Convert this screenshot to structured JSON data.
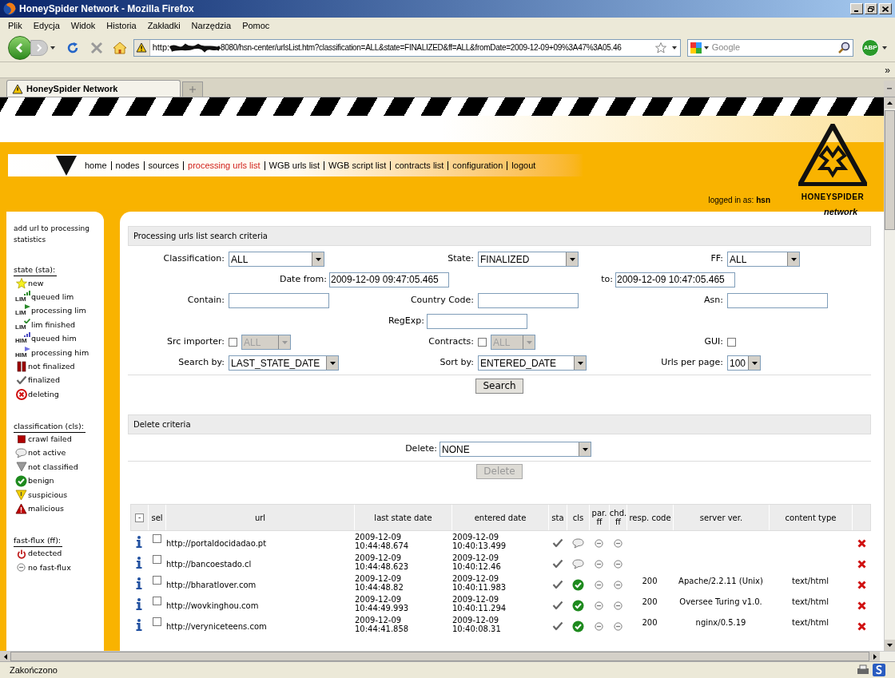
{
  "window": {
    "title": "HoneySpider Network - Mozilla Firefox"
  },
  "menu": [
    "Plik",
    "Edycja",
    "Widok",
    "Historia",
    "Zakładki",
    "Narzędzia",
    "Pomoc"
  ],
  "address_bar": {
    "scheme": "http:",
    "rest": "8080/hsn-center/urlsList.htm?classification=ALL&state=FINALIZED&ff=ALL&fromDate=2009-12-09+09%3A47%3A05.46"
  },
  "search_bar": {
    "placeholder": "Google"
  },
  "addon_button": "ABP",
  "bookmarks_overflow": "»",
  "tabs": [
    {
      "label": "HoneySpider Network",
      "selected": true
    }
  ],
  "site": {
    "nav": [
      {
        "label": "home",
        "selected": false
      },
      {
        "label": "nodes",
        "selected": false
      },
      {
        "label": "sources",
        "selected": false
      },
      {
        "label": "processing urls list",
        "selected": true
      },
      {
        "label": "WGB urls list",
        "selected": false
      },
      {
        "label": "WGB script list",
        "selected": false
      },
      {
        "label": "contracts list",
        "selected": false
      },
      {
        "label": "configuration",
        "selected": false
      },
      {
        "label": "logout",
        "selected": false
      }
    ],
    "logged_in": {
      "label": "logged in as:",
      "user": "hsn"
    },
    "logo": {
      "name": "HONEYSPIDER",
      "sub": "network"
    }
  },
  "sidebar": {
    "links": [
      "add url to processing",
      "statistics"
    ],
    "legends": [
      {
        "title": "state (sta):",
        "items": [
          {
            "kind": "new",
            "label": "new"
          },
          {
            "kind": "lim_queued",
            "label": "queued lim",
            "badge": "LIM"
          },
          {
            "kind": "lim_processing",
            "label": "processing lim",
            "badge": "LIM"
          },
          {
            "kind": "lim_finished",
            "label": "lim finished",
            "badge": "LIM"
          },
          {
            "kind": "him_queued",
            "label": "queued him",
            "badge": "HIM"
          },
          {
            "kind": "him_processing",
            "label": "processing him",
            "badge": "HIM"
          },
          {
            "kind": "not_finalized",
            "label": "not finalized"
          },
          {
            "kind": "finalized",
            "label": "finalized"
          },
          {
            "kind": "deleting",
            "label": "deleting"
          }
        ]
      },
      {
        "title": "classification (cls):",
        "items": [
          {
            "kind": "crawl_failed",
            "label": "crawl failed"
          },
          {
            "kind": "not_active",
            "label": "not active"
          },
          {
            "kind": "not_classified",
            "label": "not classified"
          },
          {
            "kind": "benign",
            "label": "benign"
          },
          {
            "kind": "suspicious",
            "label": "suspicious"
          },
          {
            "kind": "malicious",
            "label": "malicious"
          }
        ]
      },
      {
        "title": "fast-flux (ff):",
        "items": [
          {
            "kind": "detected",
            "label": "detected"
          },
          {
            "kind": "no_fast_flux",
            "label": "no fast-flux"
          }
        ]
      }
    ]
  },
  "search_form": {
    "title": "Processing urls list search criteria",
    "classification": {
      "label": "Classification:",
      "value": "ALL"
    },
    "state": {
      "label": "State:",
      "value": "FINALIZED"
    },
    "ff": {
      "label": "FF:",
      "value": "ALL"
    },
    "date_from": {
      "label": "Date from:",
      "value": "2009-12-09 09:47:05.465"
    },
    "date_to": {
      "label": "to:",
      "value": "2009-12-09 10:47:05.465"
    },
    "contain": {
      "label": "Contain:"
    },
    "country_code": {
      "label": "Country Code:"
    },
    "asn": {
      "label": "Asn:"
    },
    "regexp": {
      "label": "RegExp:"
    },
    "src_importer": {
      "label": "Src importer:",
      "checked": false,
      "value": "ALL",
      "disabled": true
    },
    "contracts": {
      "label": "Contracts:",
      "checked": false,
      "value": "ALL",
      "disabled": true
    },
    "gui": {
      "label": "GUI:",
      "checked": false
    },
    "search_by": {
      "label": "Search by:",
      "value": "LAST_STATE_DATE"
    },
    "sort_by": {
      "label": "Sort by:",
      "value": "ENTERED_DATE"
    },
    "urls_per_page": {
      "label": "Urls per page:",
      "value": "100"
    },
    "button": "Search"
  },
  "delete_form": {
    "title": "Delete criteria",
    "delete": {
      "label": "Delete:",
      "value": "NONE"
    },
    "button": {
      "label": "Delete",
      "disabled": true
    }
  },
  "table": {
    "toggle": "-",
    "columns": [
      "sel",
      "url",
      "last state date",
      "entered date",
      "sta",
      "cls",
      "par. ff",
      "chd. ff",
      "resp. code",
      "server ver.",
      "content type"
    ],
    "rows": [
      {
        "selected": false,
        "url": "http://portaldocidadao.pt",
        "last_state_date": "2009-12-09",
        "last_state_time": "10:44:48.674",
        "entered_date": "2009-12-09",
        "entered_time": "10:40:13.499",
        "sta": {
          "kind": "finalized"
        },
        "cls": {
          "kind": "not_active"
        },
        "par_ff": {
          "kind": "no_fast_flux"
        },
        "chd_ff": {
          "kind": "no_fast_flux"
        }
      },
      {
        "selected": false,
        "url": "http://bancoestado.cl",
        "last_state_date": "2009-12-09",
        "last_state_time": "10:44:48.623",
        "entered_date": "2009-12-09",
        "entered_time": "10:40:12.46",
        "sta": {
          "kind": "finalized"
        },
        "cls": {
          "kind": "not_active"
        },
        "par_ff": {
          "kind": "no_fast_flux"
        },
        "chd_ff": {
          "kind": "no_fast_flux"
        }
      },
      {
        "selected": false,
        "url": "http://bharatlover.com",
        "last_state_date": "2009-12-09",
        "last_state_time": "10:44:48.82",
        "entered_date": "2009-12-09",
        "entered_time": "10:40:11.983",
        "sta": {
          "kind": "finalized"
        },
        "cls": {
          "kind": "benign"
        },
        "par_ff": {
          "kind": "no_fast_flux"
        },
        "chd_ff": {
          "kind": "no_fast_flux"
        },
        "resp_code": "200",
        "server": "Apache/2.2.11 (Unix)",
        "content_type": "text/html"
      },
      {
        "selected": false,
        "url": "http://wovkinghou.com",
        "last_state_date": "2009-12-09",
        "last_state_time": "10:44:49.993",
        "entered_date": "2009-12-09",
        "entered_time": "10:40:11.294",
        "sta": {
          "kind": "finalized"
        },
        "cls": {
          "kind": "benign"
        },
        "par_ff": {
          "kind": "no_fast_flux"
        },
        "chd_ff": {
          "kind": "no_fast_flux"
        },
        "resp_code": "200",
        "server": "Oversee Turing v1.0.",
        "content_type": "text/html"
      },
      {
        "selected": false,
        "url": "http://veryniceteens.com",
        "last_state_date": "2009-12-09",
        "last_state_time": "10:44:41.858",
        "entered_date": "2009-12-09",
        "entered_time": "10:40:08.31",
        "sta": {
          "kind": "finalized"
        },
        "cls": {
          "kind": "benign"
        },
        "par_ff": {
          "kind": "no_fast_flux"
        },
        "chd_ff": {
          "kind": "no_fast_flux"
        },
        "resp_code": "200",
        "server": "nginx/0.5.19",
        "content_type": "text/html"
      }
    ]
  },
  "status_bar": {
    "text": "Zakończono"
  }
}
